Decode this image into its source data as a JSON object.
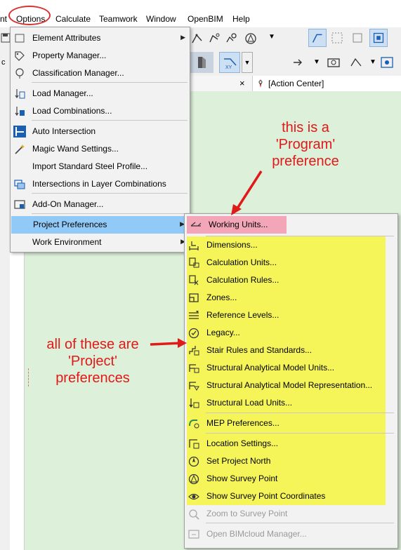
{
  "menubar": {
    "items": [
      "nt",
      "Options",
      "Calculate",
      "Teamwork",
      "Window",
      "OpenBIM",
      "Help"
    ]
  },
  "tabbar": {
    "close_glyph": "×",
    "action_center_tab": "[Action Center]"
  },
  "options_menu": {
    "items": [
      {
        "label": "Element Attributes",
        "icon": "attributes-icon",
        "submenu": true
      },
      {
        "label": "Property Manager...",
        "icon": "property-icon"
      },
      {
        "label": "Classification Manager...",
        "icon": "classification-icon"
      },
      {
        "label": "Load Manager...",
        "icon": "load-icon"
      },
      {
        "label": "Load Combinations...",
        "icon": "load-combination-icon"
      },
      {
        "label": "Auto Intersection",
        "icon": "auto-intersection-icon"
      },
      {
        "label": "Magic Wand Settings...",
        "icon": "magic-wand-icon"
      },
      {
        "label": "Import Standard Steel Profile...",
        "icon": ""
      },
      {
        "label": "Intersections in Layer Combinations",
        "icon": "layer-intersection-icon"
      },
      {
        "label": "Add-On Manager...",
        "icon": "addon-icon"
      },
      {
        "label": "Project Preferences",
        "icon": "",
        "submenu": true,
        "highlighted": true
      },
      {
        "label": "Work Environment",
        "icon": "",
        "submenu": true
      }
    ]
  },
  "project_prefs_menu": {
    "items": [
      {
        "label": "Working Units...",
        "icon": "working-units-icon",
        "highlighted": true
      },
      {
        "label": "Dimensions...",
        "icon": "dimensions-icon"
      },
      {
        "label": "Calculation Units...",
        "icon": "calculation-units-icon"
      },
      {
        "label": "Calculation Rules...",
        "icon": "calculation-rules-icon"
      },
      {
        "label": "Zones...",
        "icon": "zones-icon"
      },
      {
        "label": "Reference Levels...",
        "icon": "reference-levels-icon"
      },
      {
        "label": "Legacy...",
        "icon": "legacy-icon"
      },
      {
        "label": "Stair Rules and Standards...",
        "icon": "stair-rules-icon"
      },
      {
        "label": "Structural Analytical Model Units...",
        "icon": "sam-units-icon"
      },
      {
        "label": "Structural Analytical Model Representation...",
        "icon": "sam-representation-icon"
      },
      {
        "label": "Structural Load Units...",
        "icon": "structural-load-units-icon"
      },
      {
        "label": "MEP Preferences...",
        "icon": "mep-icon"
      },
      {
        "label": "Location Settings...",
        "icon": "location-icon"
      },
      {
        "label": "Set Project North",
        "icon": "project-north-icon"
      },
      {
        "label": "Show Survey Point",
        "icon": "survey-point-icon"
      },
      {
        "label": "Show Survey Point Coordinates",
        "icon": "survey-coordinates-icon"
      },
      {
        "label": "Zoom to Survey Point",
        "icon": "zoom-survey-icon",
        "disabled": true
      },
      {
        "label": "Open BIMcloud Manager...",
        "icon": "bimcloud-icon",
        "disabled": true
      }
    ]
  },
  "annotations": {
    "program_note": [
      "this is a",
      "'Program'",
      "preference"
    ],
    "project_note": [
      "all of these are",
      "'Project'",
      "preferences"
    ]
  },
  "colors": {
    "annotation_red": "#e01919",
    "yellow_highlight": "#f5f55a",
    "pink_highlight": "#f4a6b9",
    "menu_selection": "#91c9f7"
  }
}
